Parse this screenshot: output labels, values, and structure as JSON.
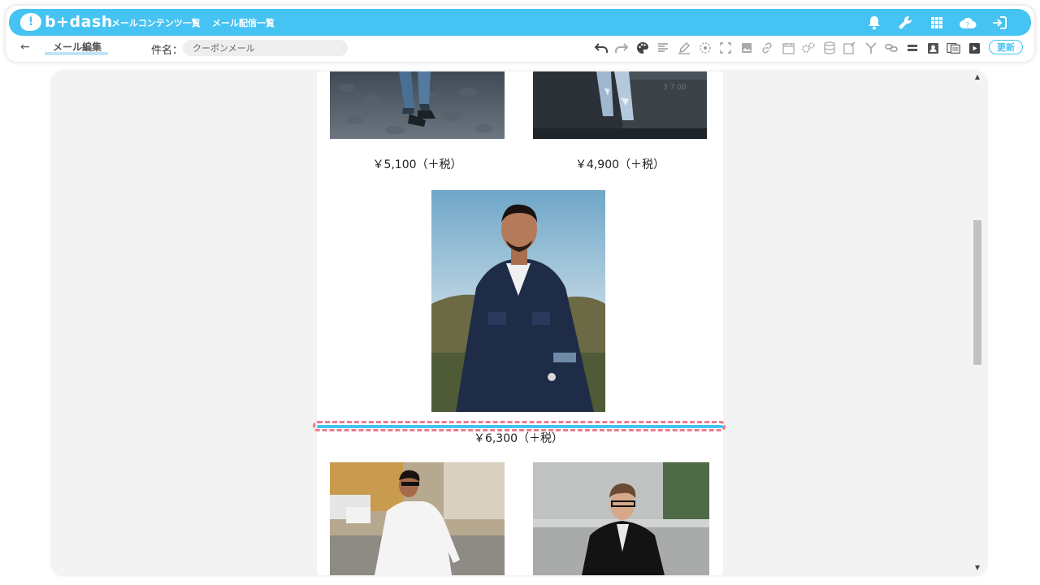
{
  "app": {
    "logo_text": "b+dash",
    "nav": [
      "メールコンテンツ一覧",
      "メール配信一覧"
    ]
  },
  "top_icons": [
    "bell-icon",
    "wrench-icon",
    "grid-icon",
    "help-cloud-icon",
    "logout-icon"
  ],
  "toolbar": {
    "back_label": "←",
    "breadcrumb": "メール編集",
    "subject_label": "件名：",
    "subject_value": "クーポンメール",
    "update_label": "更新",
    "tools": [
      "undo-icon",
      "redo-icon",
      "palette-icon",
      "text-align-icon",
      "pen-icon",
      "target-icon",
      "expand-icon",
      "image-icon",
      "link-icon",
      "calendar-icon",
      "gears-icon",
      "database-icon",
      "edit-doc-icon",
      "split-icon",
      "link-chain-icon",
      "bar-icon",
      "contact-card-icon",
      "cards-icon",
      "video-icon"
    ]
  },
  "email": {
    "products": [
      {
        "price": "￥5,100（＋税）"
      },
      {
        "price": "￥4,900（＋税）"
      },
      {
        "price": "￥6,300（＋税）"
      }
    ]
  },
  "colors": {
    "brand": "#45c3f2",
    "selection": "#f07c8a",
    "canvas_bg": "#f3f3f3"
  }
}
